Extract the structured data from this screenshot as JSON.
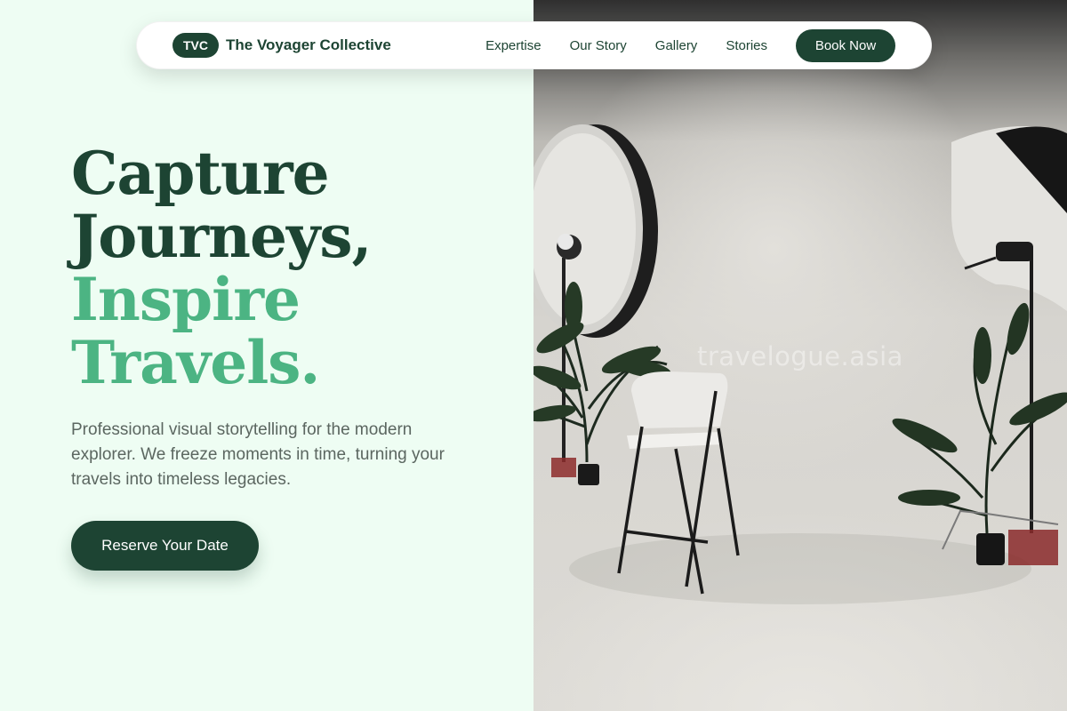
{
  "nav": {
    "brand_badge": "TVC",
    "brand_name": "The Voyager Collective",
    "links": [
      "Expertise",
      "Our Story",
      "Gallery",
      "Stories"
    ],
    "cta": "Book Now"
  },
  "hero": {
    "title_line1": "Capture",
    "title_line2": "Journeys,",
    "title_line3": "Inspire",
    "title_line4": "Travels.",
    "subtitle": "Professional visual storytelling for the modern explorer. We freeze moments in time, turning your travels into timeless legacies.",
    "button": "Reserve Your Date"
  },
  "photo": {
    "watermark": "travelogue.asia"
  },
  "colors": {
    "brand_dark": "#1d4433",
    "brand_accent": "#4cb483",
    "page_background": "#eefdf3"
  }
}
